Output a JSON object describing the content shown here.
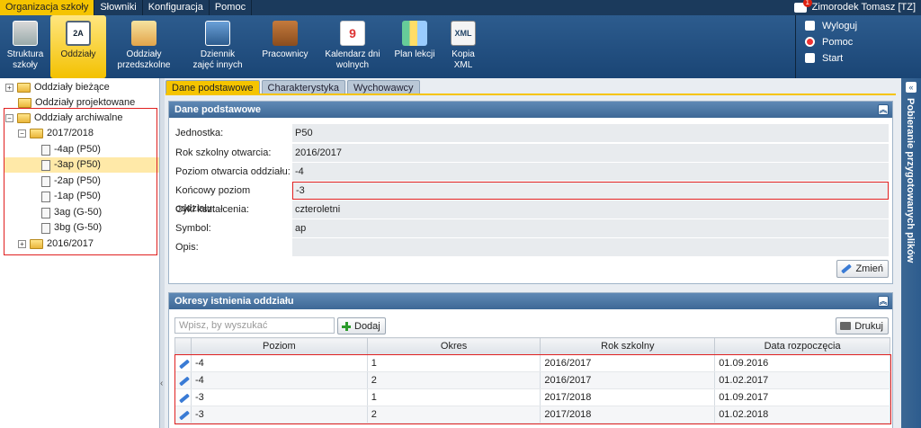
{
  "menu": {
    "items": [
      "Organizacja szkoły",
      "Słowniki",
      "Konfiguracja",
      "Pomoc"
    ],
    "user": "Zimorodek Tomasz [TZ]",
    "notification_count": "1"
  },
  "ribbon": {
    "buttons": [
      {
        "label1": "Struktura",
        "label2": "szkoły",
        "icon": "school-structure-icon"
      },
      {
        "label1": "Oddziały",
        "label2": "",
        "icon": "classes-icon",
        "glyph": "2A"
      },
      {
        "label1": "Oddziały",
        "label2": "przedszkolne",
        "icon": "preschool-classes-icon"
      },
      {
        "label1": "Dziennik",
        "label2": "zajęć innych",
        "icon": "journal-icon"
      },
      {
        "label1": "Pracownicy",
        "label2": "",
        "icon": "staff-icon"
      },
      {
        "label1": "Kalendarz dni",
        "label2": "wolnych",
        "icon": "calendar-icon",
        "glyph": "9"
      },
      {
        "label1": "Plan lekcji",
        "label2": "",
        "icon": "timetable-icon"
      },
      {
        "label1": "Kopia",
        "label2": "XML",
        "icon": "xml-icon",
        "glyph": "XML"
      }
    ],
    "right_links": [
      "Wyloguj",
      "Pomoc",
      "Start"
    ]
  },
  "tree": {
    "root_current": "Oddziały bieżące",
    "root_planned": "Oddziały projektowane",
    "root_archive": "Oddziały archiwalne",
    "year_open": "2017/2018",
    "classes": [
      "-4ap (P50)",
      "-3ap (P50)",
      "-2ap (P50)",
      "-1ap (P50)",
      "3ag (G-50)",
      "3bg (G-50)"
    ],
    "year_closed": "2016/2017"
  },
  "tabs": [
    "Dane podstawowe",
    "Charakterystyka",
    "Wychowawcy"
  ],
  "basic": {
    "title": "Dane podstawowe",
    "fields": [
      {
        "label": "Jednostka:",
        "value": "P50"
      },
      {
        "label": "Rok szkolny otwarcia:",
        "value": "2016/2017"
      },
      {
        "label": "Poziom otwarcia oddziału:",
        "value": "-4"
      },
      {
        "label": "Końcowy poziom oddziału:",
        "value": "-3"
      },
      {
        "label": "Cykl kształcenia:",
        "value": "czteroletni"
      },
      {
        "label": "Symbol:",
        "value": "ap"
      },
      {
        "label": "Opis:",
        "value": ""
      }
    ],
    "edit_label": "Zmień"
  },
  "periods": {
    "title": "Okresy istnienia oddziału",
    "search_placeholder": "Wpisz, by wyszukać",
    "add_label": "Dodaj",
    "print_label": "Drukuj",
    "columns": [
      "Poziom",
      "Okres",
      "Rok szkolny",
      "Data rozpoczęcia"
    ],
    "rows": [
      [
        "-4",
        "1",
        "2016/2017",
        "01.09.2016"
      ],
      [
        "-4",
        "2",
        "2016/2017",
        "01.02.2017"
      ],
      [
        "-3",
        "1",
        "2017/2018",
        "01.09.2017"
      ],
      [
        "-3",
        "2",
        "2017/2018",
        "01.02.2018"
      ]
    ]
  },
  "sidebar": {
    "title": "Pobieranie przygotowanych plików"
  }
}
